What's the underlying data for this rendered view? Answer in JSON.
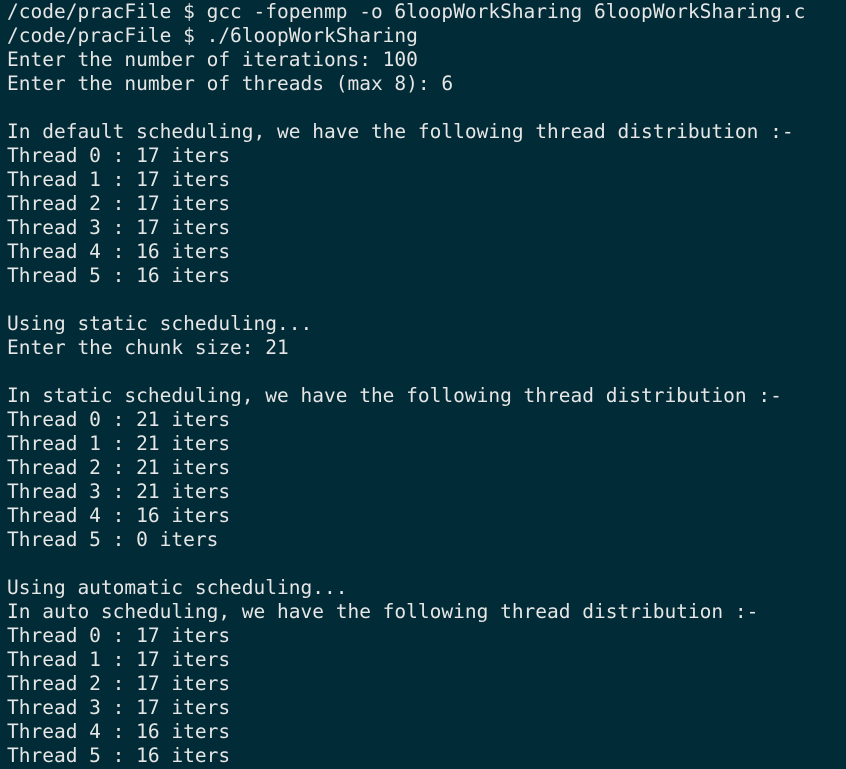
{
  "terminal": {
    "lines": [
      "/code/pracFile $ gcc -fopenmp -o 6loopWorkSharing 6loopWorkSharing.c",
      "/code/pracFile $ ./6loopWorkSharing",
      "Enter the number of iterations: 100",
      "Enter the number of threads (max 8): 6",
      "",
      "In default scheduling, we have the following thread distribution :-",
      "Thread 0 : 17 iters",
      "Thread 1 : 17 iters",
      "Thread 2 : 17 iters",
      "Thread 3 : 17 iters",
      "Thread 4 : 16 iters",
      "Thread 5 : 16 iters",
      "",
      "Using static scheduling...",
      "Enter the chunk size: 21",
      "",
      "In static scheduling, we have the following thread distribution :-",
      "Thread 0 : 21 iters",
      "Thread 1 : 21 iters",
      "Thread 2 : 21 iters",
      "Thread 3 : 21 iters",
      "Thread 4 : 16 iters",
      "Thread 5 : 0 iters",
      "",
      "Using automatic scheduling...",
      "In auto scheduling, we have the following thread distribution :-",
      "Thread 0 : 17 iters",
      "Thread 1 : 17 iters",
      "Thread 2 : 17 iters",
      "Thread 3 : 17 iters",
      "Thread 4 : 16 iters",
      "Thread 5 : 16 iters"
    ]
  },
  "colors": {
    "background": "#012b36",
    "text": "#e6e6e6"
  }
}
